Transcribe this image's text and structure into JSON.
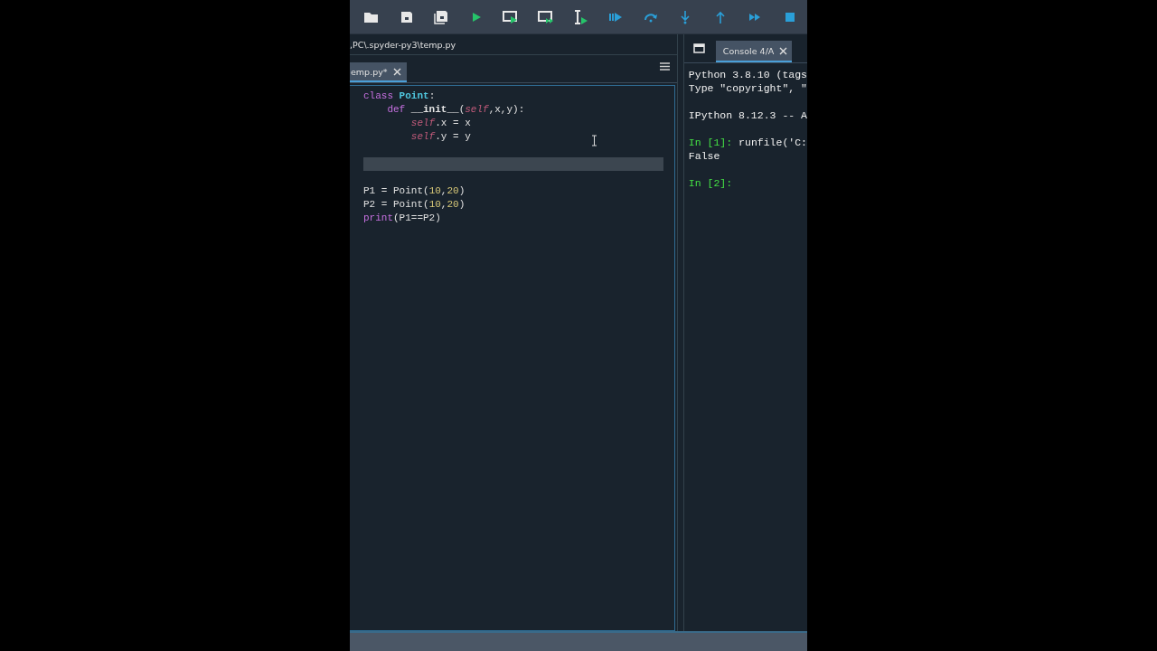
{
  "toolbar": {
    "buttons": [
      {
        "kind": "open"
      },
      {
        "kind": "save"
      },
      {
        "kind": "save-all"
      },
      {
        "kind": "run"
      },
      {
        "kind": "run-cell"
      },
      {
        "kind": "run-cell-advance"
      },
      {
        "kind": "run-selection"
      },
      {
        "kind": "debug"
      },
      {
        "kind": "step-over"
      },
      {
        "kind": "step-into"
      },
      {
        "kind": "step-out"
      },
      {
        "kind": "continue"
      },
      {
        "kind": "stop"
      }
    ]
  },
  "editor": {
    "path": ",PC\\.spyder-py3\\temp.py",
    "tabs": [
      {
        "label": "emp.py*",
        "selected": true
      }
    ],
    "lines": [
      {
        "kind": "code",
        "current": false,
        "tokens": [
          {
            "text": "class ",
            "kind": "keyword"
          },
          {
            "text": "Point",
            "kind": "classname"
          },
          {
            "text": ":",
            "kind": "plain"
          }
        ]
      },
      {
        "kind": "code",
        "current": false,
        "tokens": [
          {
            "text": "    def ",
            "kind": "keyword"
          },
          {
            "text": "__init__",
            "kind": "funcname"
          },
          {
            "text": "(",
            "kind": "plain"
          },
          {
            "text": "self",
            "kind": "self"
          },
          {
            "text": ",x,y):",
            "kind": "plain"
          }
        ]
      },
      {
        "kind": "code",
        "current": false,
        "tokens": [
          {
            "text": "        self",
            "kind": "self"
          },
          {
            "text": ".x = x",
            "kind": "plain"
          }
        ]
      },
      {
        "kind": "code",
        "current": false,
        "tokens": [
          {
            "text": "        self",
            "kind": "self"
          },
          {
            "text": ".y = y",
            "kind": "plain"
          }
        ]
      },
      {
        "kind": "blank",
        "current": false
      },
      {
        "kind": "blank",
        "current": true
      },
      {
        "kind": "blank",
        "current": false
      },
      {
        "kind": "code",
        "current": false,
        "tokens": [
          {
            "text": "P1 = Point(",
            "kind": "plain"
          },
          {
            "text": "10",
            "kind": "number"
          },
          {
            "text": ",",
            "kind": "plain"
          },
          {
            "text": "20",
            "kind": "number"
          },
          {
            "text": ")",
            "kind": "plain"
          }
        ]
      },
      {
        "kind": "code",
        "current": false,
        "tokens": [
          {
            "text": "P2 = Point(",
            "kind": "plain"
          },
          {
            "text": "10",
            "kind": "number"
          },
          {
            "text": ",",
            "kind": "plain"
          },
          {
            "text": "20",
            "kind": "number"
          },
          {
            "text": ")",
            "kind": "plain"
          }
        ]
      },
      {
        "kind": "code",
        "current": false,
        "tokens": [
          {
            "text": "print",
            "kind": "builtin"
          },
          {
            "text": "(P1==P2)",
            "kind": "plain"
          }
        ]
      }
    ]
  },
  "console": {
    "tabs": [
      {
        "label": "Console 4/A",
        "selected": true
      }
    ],
    "lines": [
      {
        "kind": "text",
        "tokens": [
          {
            "text": "Python 3.8.10 (tags",
            "kind": "plain"
          }
        ]
      },
      {
        "kind": "text",
        "tokens": [
          {
            "text": "Type \"copyright\", \"",
            "kind": "plain"
          }
        ]
      },
      {
        "kind": "blank"
      },
      {
        "kind": "text",
        "tokens": [
          {
            "text": "IPython 8.12.3 -- A",
            "kind": "plain"
          }
        ]
      },
      {
        "kind": "blank"
      },
      {
        "kind": "text",
        "tokens": [
          {
            "text": "In [1]:",
            "kind": "prompt"
          },
          {
            "text": " runfile('C:",
            "kind": "plain"
          }
        ]
      },
      {
        "kind": "text",
        "tokens": [
          {
            "text": "False",
            "kind": "plain"
          }
        ]
      },
      {
        "kind": "blank"
      },
      {
        "kind": "text",
        "tokens": [
          {
            "text": "In [2]:",
            "kind": "prompt"
          }
        ]
      }
    ]
  }
}
